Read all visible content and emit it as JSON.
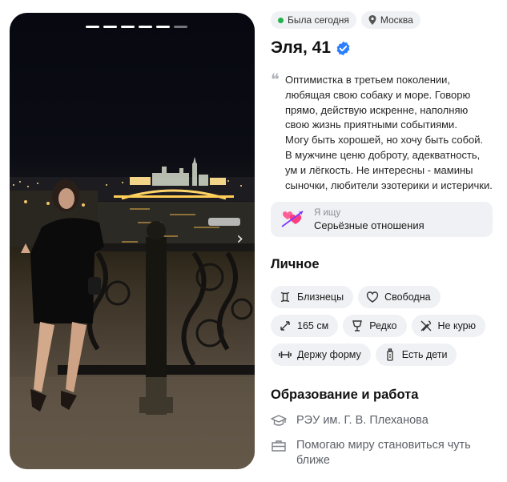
{
  "photo": {
    "progress_total": 5,
    "progress_active": 5,
    "next_icon": "chevron-right-icon"
  },
  "status": {
    "online_text": "Была сегодня",
    "location": "Москва"
  },
  "profile": {
    "name_age": "Эля, 41",
    "verified": true,
    "bio": "Оптимистка в третьем поколении, любящая свою собаку и море. Говорю прямо, действую искренне, наполняю свою жизнь приятными событиями.\nМогу быть хорошей, но хочу быть собой.\nВ мужчине ценю доброту, адекватность, ум и лёгкость. Не интересны - мамины сыночки, любители эзотерики и истерички."
  },
  "looking_for": {
    "label": "Я ищу",
    "value": "Серьёзные отношения",
    "icon": "hearts-arrow-icon"
  },
  "personal": {
    "title": "Личное",
    "tags": [
      {
        "icon": "gemini-icon",
        "label": "Близнецы"
      },
      {
        "icon": "heart-outline-icon",
        "label": "Свободна"
      },
      {
        "icon": "height-icon",
        "label": "165 см"
      },
      {
        "icon": "glass-icon",
        "label": "Редко"
      },
      {
        "icon": "no-smoking-icon",
        "label": "Не курю"
      },
      {
        "icon": "dumbbell-icon",
        "label": "Держу форму"
      },
      {
        "icon": "baby-bottle-icon",
        "label": "Есть дети"
      }
    ]
  },
  "education": {
    "title": "Образование и работа",
    "university": "РЭУ им. Г. В. Плеханова",
    "work": "Помогаю миру становиться чуть ближе"
  },
  "colors": {
    "online": "#22b14c",
    "verified": "#2b7fff",
    "chip_bg": "#f0f1f4"
  }
}
